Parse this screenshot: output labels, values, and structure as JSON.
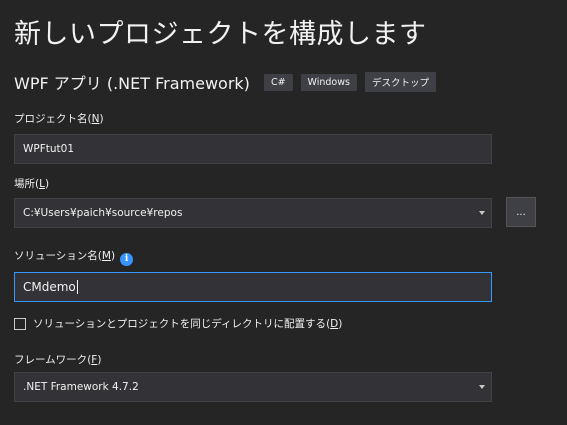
{
  "page": {
    "title": "新しいプロジェクトを構成します"
  },
  "template": {
    "name": "WPF アプリ (.NET Framework)",
    "tags": [
      "C#",
      "Windows",
      "デスクトップ"
    ]
  },
  "project_name": {
    "label": "プロジェクト名",
    "access_key": "N",
    "value": "WPFtut01"
  },
  "location": {
    "label": "場所",
    "access_key": "L",
    "value": "C:¥Users¥paich¥source¥repos",
    "browse_label": "..."
  },
  "solution_name": {
    "label": "ソリューション名",
    "access_key": "M",
    "info_icon": "i",
    "value": "CMdemo"
  },
  "same_directory": {
    "label": "ソリューションとプロジェクトを同じディレクトリに配置する",
    "access_key": "D",
    "checked": false
  },
  "framework": {
    "label": "フレームワーク",
    "access_key": "F",
    "value": ".NET Framework 4.7.2"
  },
  "colors": {
    "background": "#252526",
    "field_background": "#333337",
    "field_border": "#434346",
    "focus_border": "#3399ff",
    "tag_background": "#3f3f46",
    "info_icon": "#3794ff"
  }
}
